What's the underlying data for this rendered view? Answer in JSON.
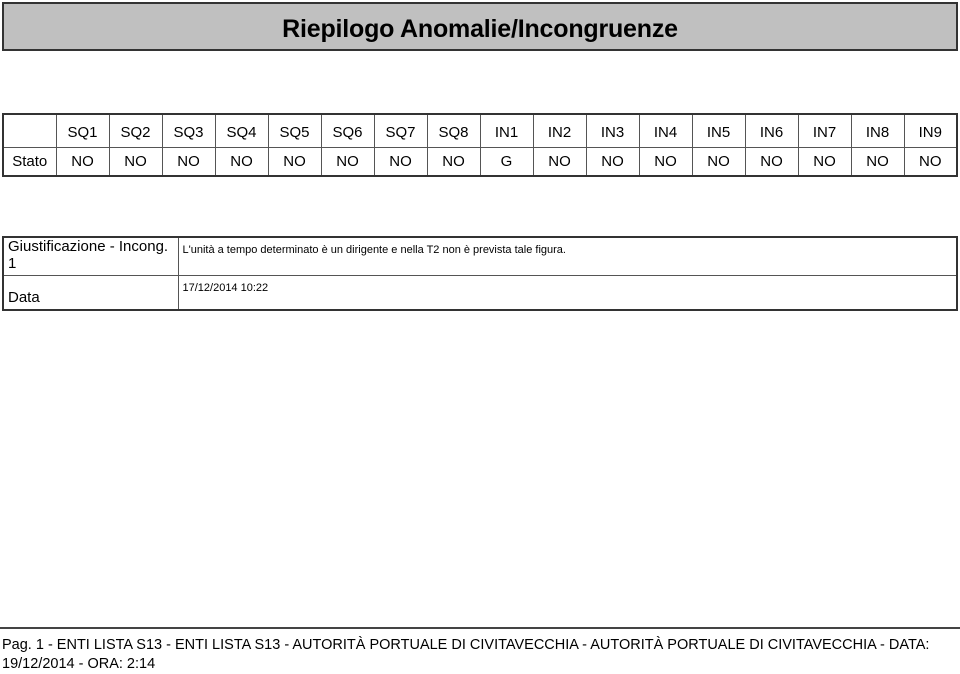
{
  "title": "Riepilogo Anomalie/Incongruenze",
  "status_table": {
    "row_label": "Stato",
    "columns": [
      "SQ1",
      "SQ2",
      "SQ3",
      "SQ4",
      "SQ5",
      "SQ6",
      "SQ7",
      "SQ8",
      "IN1",
      "IN2",
      "IN3",
      "IN4",
      "IN5",
      "IN6",
      "IN7",
      "IN8",
      "IN9"
    ],
    "values": [
      "NO",
      "NO",
      "NO",
      "NO",
      "NO",
      "NO",
      "NO",
      "NO",
      "G",
      "NO",
      "NO",
      "NO",
      "NO",
      "NO",
      "NO",
      "NO",
      "NO"
    ]
  },
  "justification": {
    "rows": [
      {
        "label": "Giustificazione - Incong. 1",
        "value": "L'unità a tempo determinato è un dirigente e nella T2 non è prevista tale figura."
      },
      {
        "label": "Data",
        "value": "17/12/2014 10:22"
      }
    ]
  },
  "footer": {
    "text": "Pag. 1 - ENTI LISTA S13 - ENTI LISTA S13 - AUTORITÀ PORTUALE DI CIVITAVECCHIA - AUTORITÀ PORTUALE DI CIVITAVECCHIA - DATA: 19/12/2014 - ORA: 2:14"
  }
}
